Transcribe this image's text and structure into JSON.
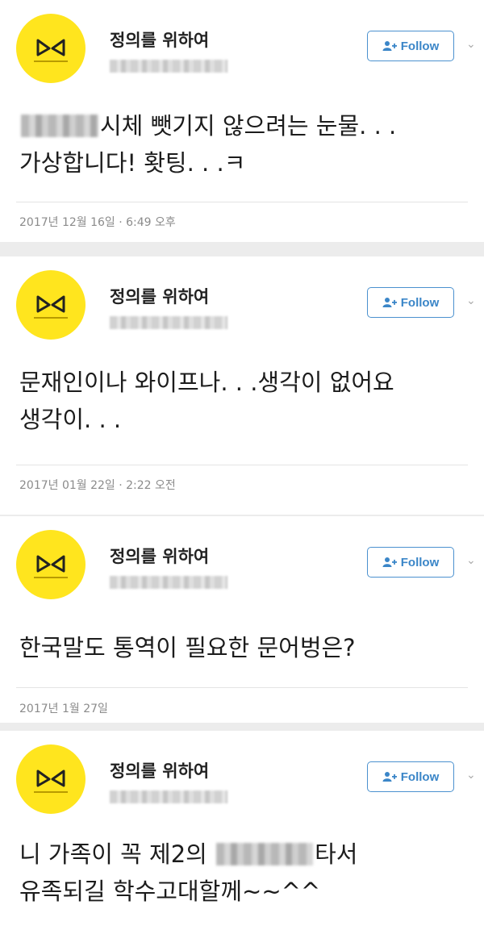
{
  "tweets": [
    {
      "name": "정의를 위하여",
      "follow_label": "Follow",
      "text_before": "",
      "text_after": "시체 뺏기지 않으려는 눈물. . .\n가상합니다! 홧팅. . .ㅋ",
      "timestamp": "2017년 12월 16일 · 6:49 오후"
    },
    {
      "name": "정의를 위하여",
      "follow_label": "Follow",
      "text_before": "문재인이나 와이프나. . .생각이 없어요\n생각이. . .",
      "text_after": "",
      "timestamp": "2017년 01월 22일 · 2:22 오전"
    },
    {
      "name": "정의를 위하여",
      "follow_label": "Follow",
      "text_before": "한국말도 통역이 필요한 문어벙은?",
      "text_after": "",
      "timestamp": "2017년 1월 27일"
    },
    {
      "name": "정의를 위하여",
      "follow_label": "Follow",
      "text_before": "니 가족이 꼭 제2의 ",
      "text_after": "타서\n유족되길 학수고대할께~~^^",
      "timestamp": ""
    }
  ],
  "colors": {
    "avatar": "#ffe51e",
    "follow": "#3b86c8",
    "timestamp": "#8b8b8b",
    "background": "#ececec"
  },
  "icons": {
    "follow": "add-user-icon",
    "menu": "chevron-down-icon",
    "avatar_logo": "ribbon-logo-icon"
  }
}
